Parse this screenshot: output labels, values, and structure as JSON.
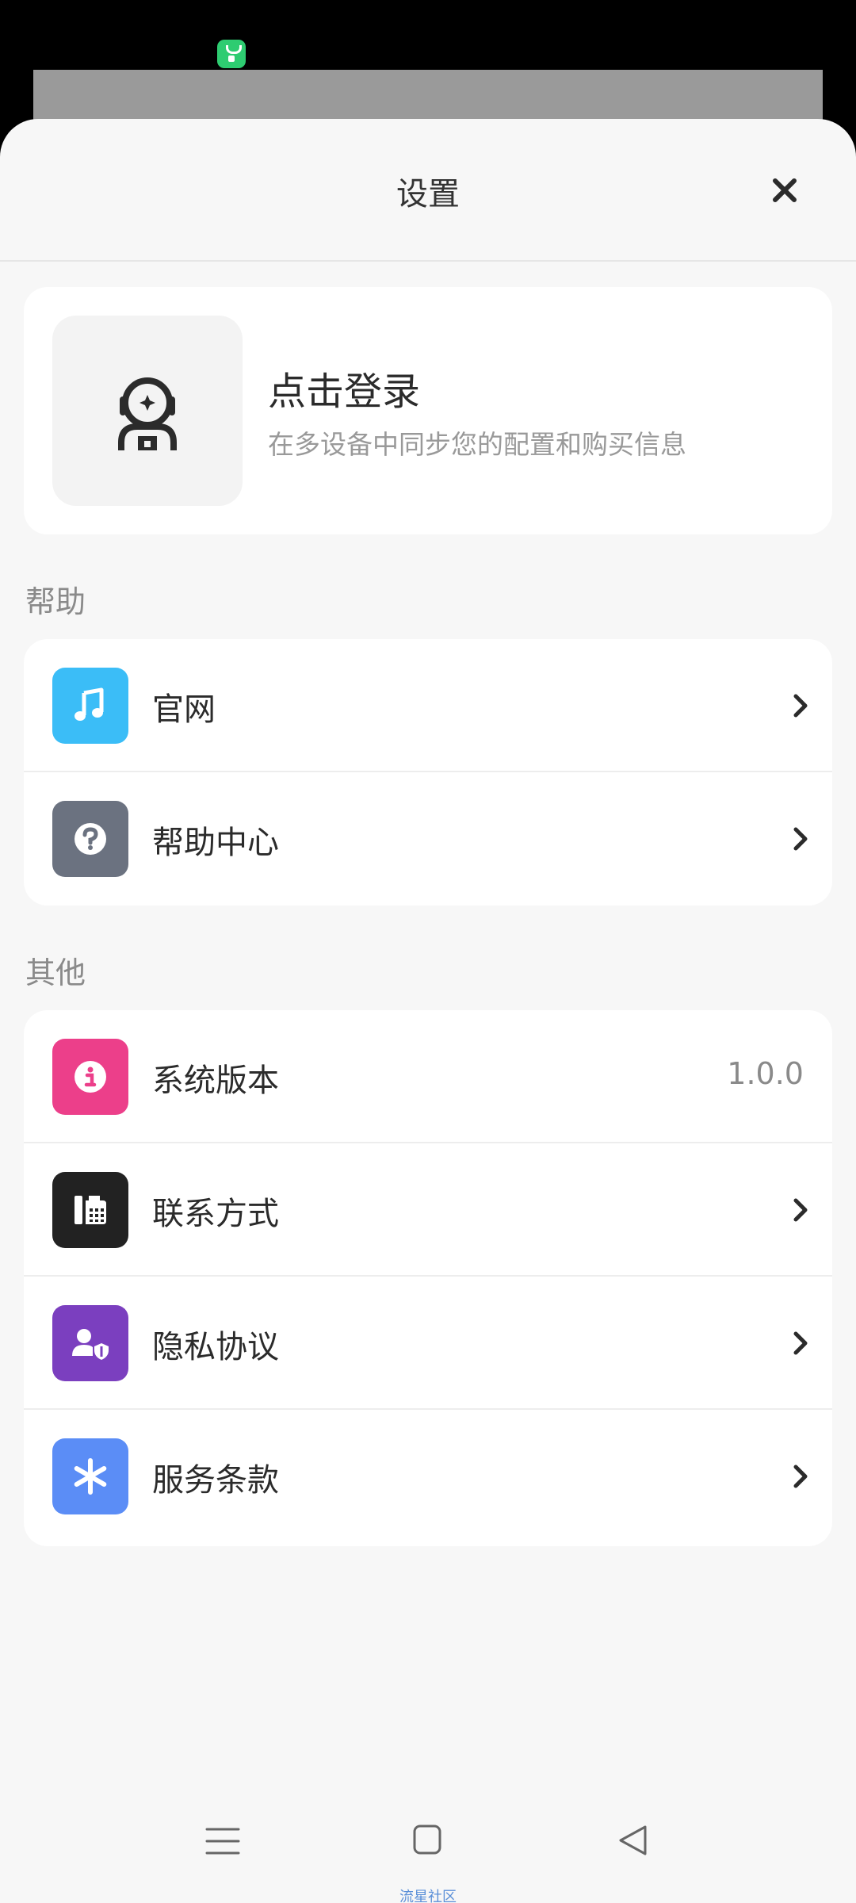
{
  "sheet": {
    "title": "设置"
  },
  "login": {
    "title": "点击登录",
    "subtitle": "在多设备中同步您的配置和购买信息",
    "avatar_icon": "astronaut-icon"
  },
  "sections": {
    "help": {
      "label": "帮助",
      "items": [
        {
          "label": "官网",
          "icon": "music-note-icon",
          "color": "#3bbdf7"
        },
        {
          "label": "帮助中心",
          "icon": "question-circle-icon",
          "color": "#6b7280"
        }
      ]
    },
    "other": {
      "label": "其他",
      "items": [
        {
          "label": "系统版本",
          "icon": "info-circle-icon",
          "color": "#ec3f8a",
          "value": "1.0.0"
        },
        {
          "label": "联系方式",
          "icon": "fax-icon",
          "color": "#222222"
        },
        {
          "label": "隐私协议",
          "icon": "user-shield-icon",
          "color": "#7b3fbf"
        },
        {
          "label": "服务条款",
          "icon": "asterisk-icon",
          "color": "#5b8df6"
        }
      ]
    }
  },
  "navbar": {
    "caption": "流星社区"
  }
}
